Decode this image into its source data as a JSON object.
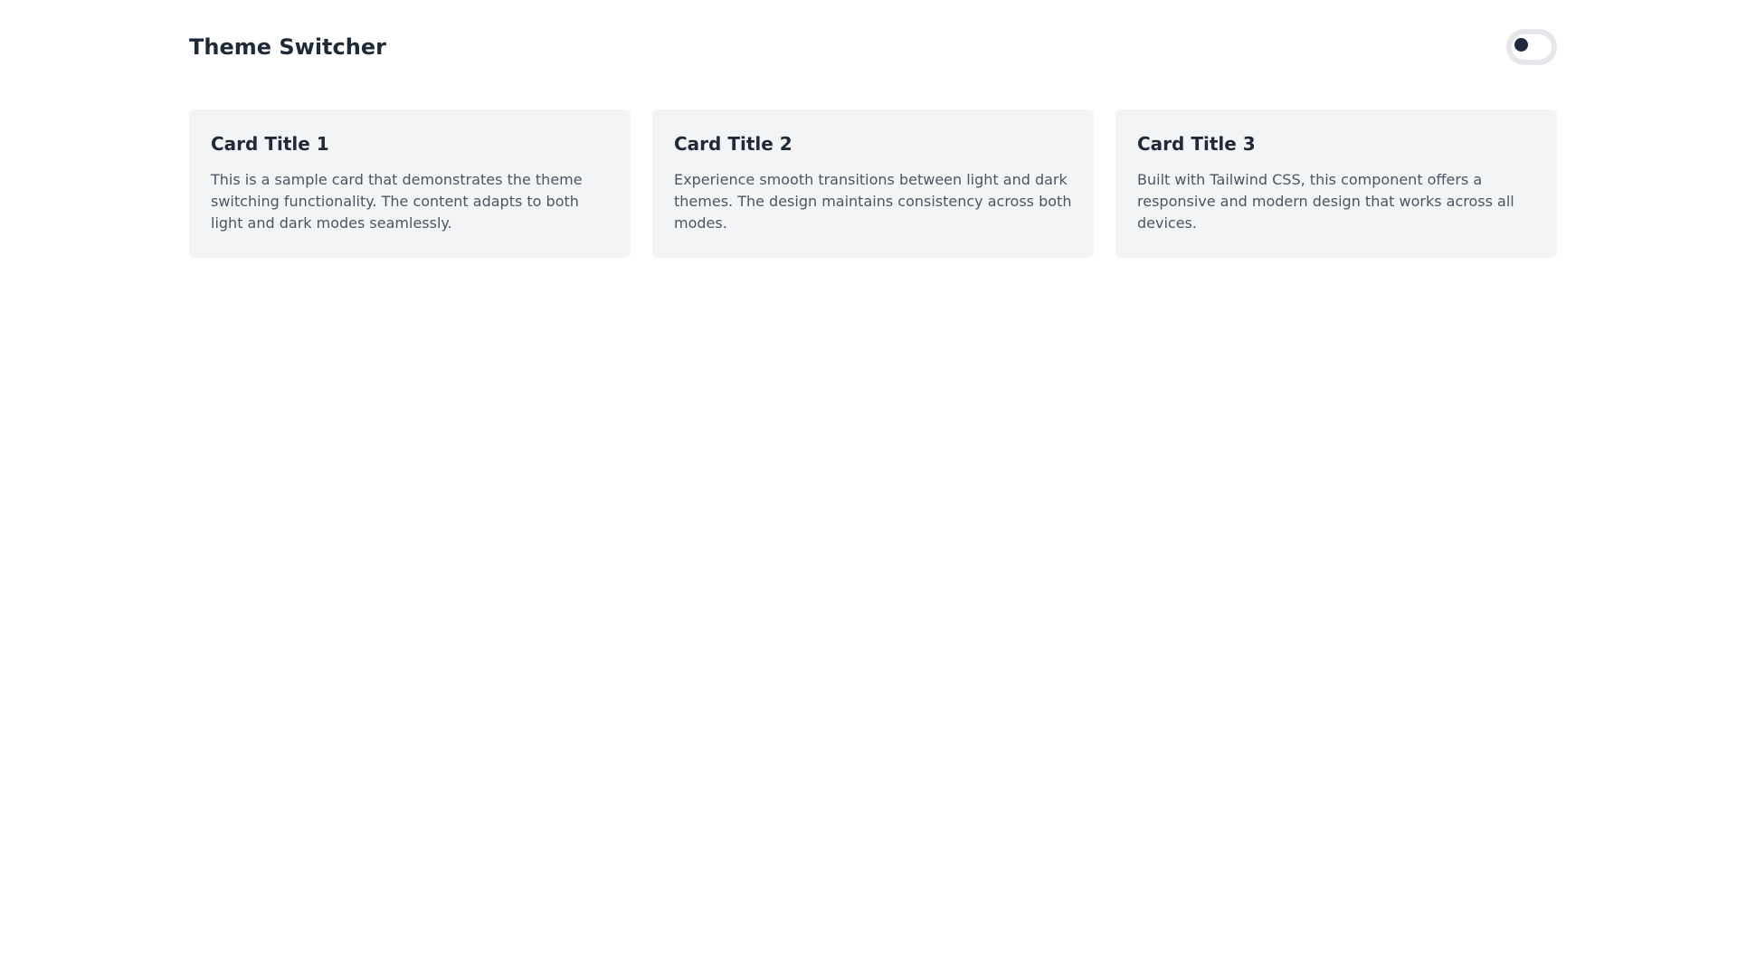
{
  "header": {
    "title": "Theme Switcher",
    "toggle": {
      "icon": "theme-toggle-switch",
      "state": "light"
    }
  },
  "cards": [
    {
      "title": "Card Title 1",
      "text": "This is a sample card that demonstrates the theme switching functionality. The content adapts to both light and dark modes seamlessly."
    },
    {
      "title": "Card Title 2",
      "text": "Experience smooth transitions between light and dark themes. The design maintains consistency across both modes."
    },
    {
      "title": "Card Title 3",
      "text": "Built with Tailwind CSS, this component offers a responsive and modern design that works across all devices."
    }
  ],
  "colors": {
    "background": "#ffffff",
    "card_background": "#f3f4f6",
    "heading_text": "#1f2937",
    "body_text": "#4b5563",
    "toggle_track": "#e5e7eb",
    "toggle_knob": "#1e293b"
  }
}
